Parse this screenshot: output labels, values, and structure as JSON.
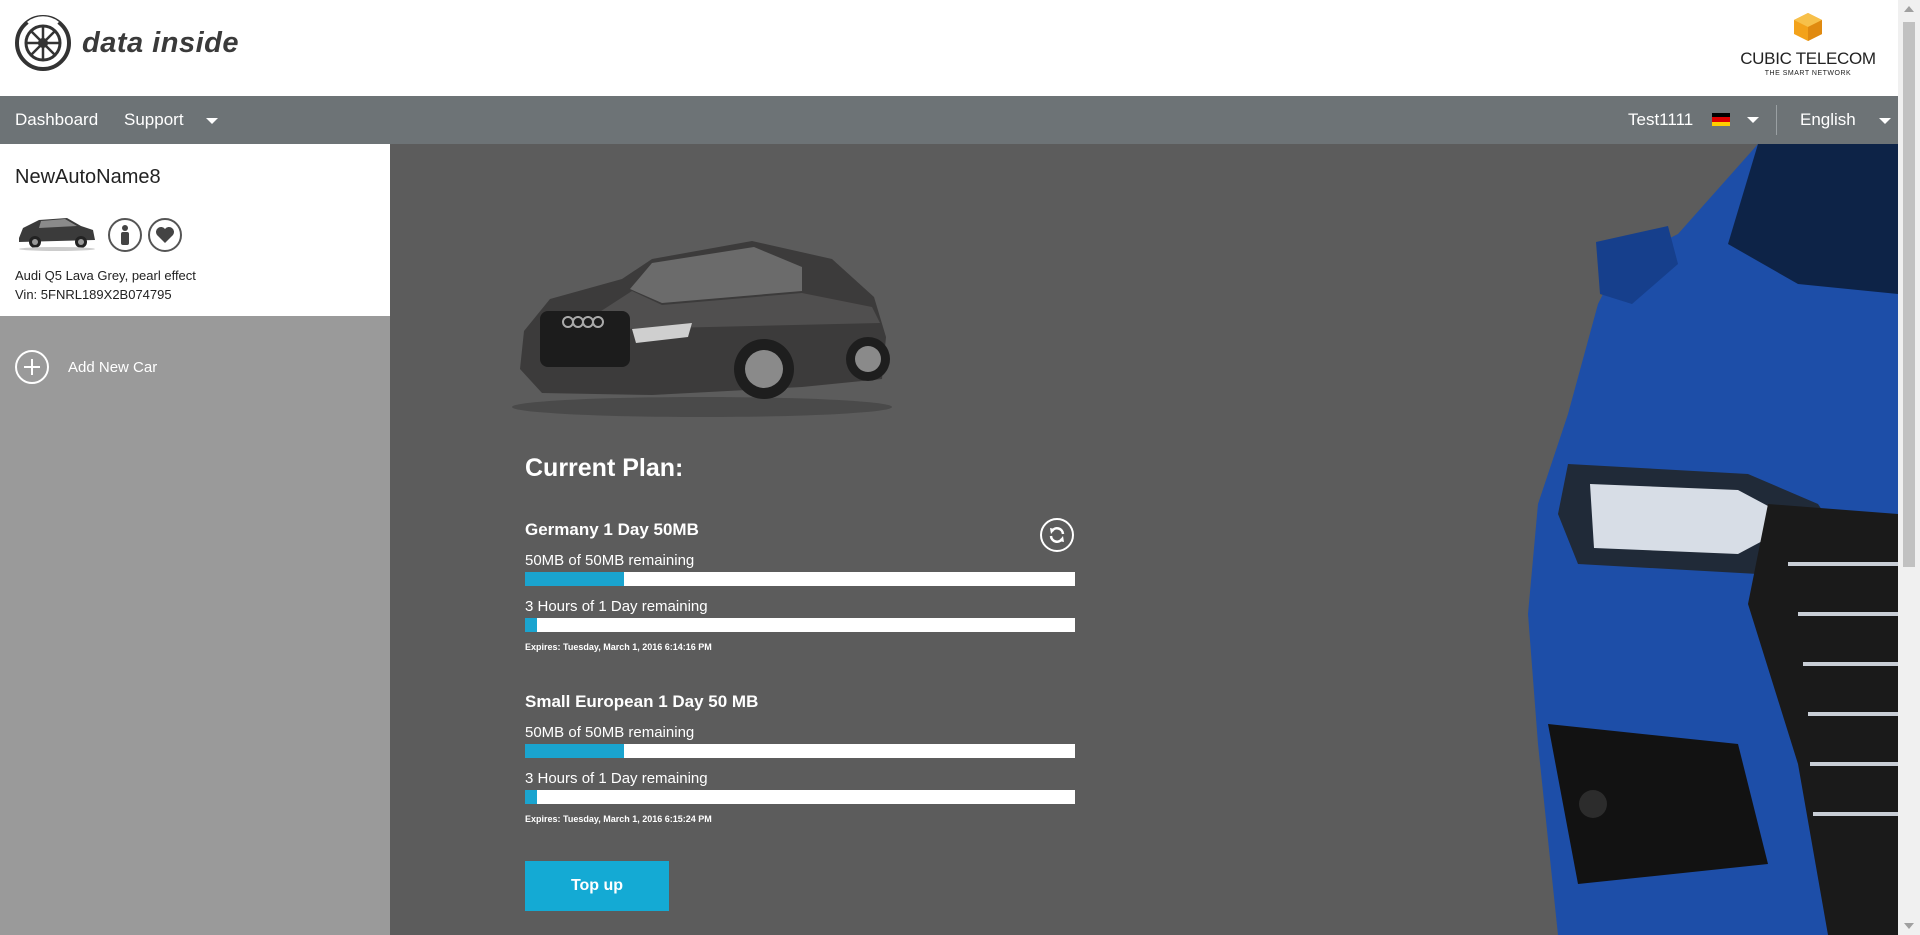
{
  "brand": {
    "name": "data inside",
    "partner_name": "CUBIC TELECOM",
    "partner_tagline": "THE SMART NETWORK"
  },
  "nav": {
    "dashboard": "Dashboard",
    "support": "Support",
    "user": "Test1111",
    "language": "English"
  },
  "sidebar": {
    "car_name": "NewAutoName8",
    "car_model": "Audi Q5 Lava Grey, pearl effect",
    "car_vin": "Vin: 5FNRL189X2B074795",
    "add_car": "Add New Car"
  },
  "main": {
    "plan_title": "Current Plan:",
    "plans": [
      {
        "name": "Germany 1 Day 50MB",
        "data_line": "50MB of 50MB remaining",
        "data_fill": 0.18,
        "time_line": "3 Hours of 1 Day remaining",
        "time_fill": 0.022,
        "expires": "Expires: Tuesday, March 1, 2016 6:14:16 PM"
      },
      {
        "name": "Small European 1 Day 50 MB",
        "data_line": "50MB of 50MB remaining",
        "data_fill": 0.18,
        "time_line": "3 Hours of 1 Day remaining",
        "time_fill": 0.022,
        "expires": "Expires: Tuesday, March 1, 2016 6:15:24 PM"
      }
    ],
    "topup_label": "Top up"
  },
  "colors": {
    "accent": "#1aa4cf",
    "nav_bg": "#6d7376",
    "main_bg": "#5c5c5c",
    "sidebar_bg": "#9a9a9a"
  }
}
